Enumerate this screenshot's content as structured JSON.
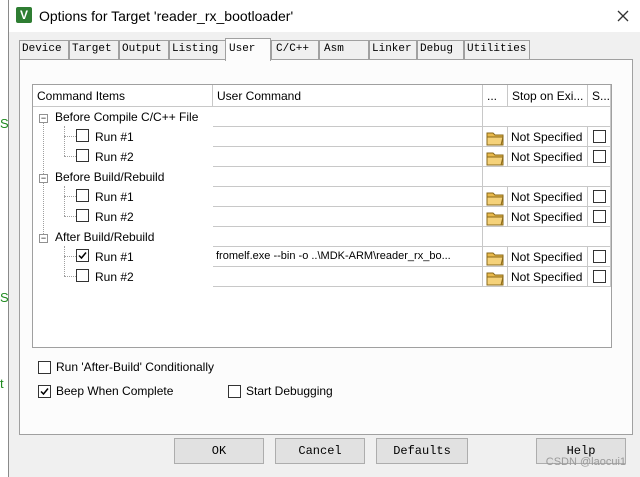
{
  "window": {
    "title": "Options for Target 'reader_rx_bootloader'",
    "icon_glyph": "V"
  },
  "tabs": [
    {
      "label": "Device"
    },
    {
      "label": "Target"
    },
    {
      "label": "Output"
    },
    {
      "label": "Listing"
    },
    {
      "label": "User"
    },
    {
      "label": "C/C++"
    },
    {
      "label": "Asm"
    },
    {
      "label": "Linker"
    },
    {
      "label": "Debug"
    },
    {
      "label": "Utilities"
    }
  ],
  "active_tab": "User",
  "grid": {
    "headers": [
      "Command Items",
      "User Command",
      "...",
      "Stop on Exi...",
      "S..."
    ],
    "groups": [
      {
        "label": "Before Compile C/C++ File",
        "expander": "−",
        "runs": [
          {
            "label": "Run #1",
            "checked": false,
            "command": "",
            "stop": "Not Specified"
          },
          {
            "label": "Run #2",
            "checked": false,
            "command": "",
            "stop": "Not Specified"
          }
        ]
      },
      {
        "label": "Before Build/Rebuild",
        "expander": "−",
        "runs": [
          {
            "label": "Run #1",
            "checked": false,
            "command": "",
            "stop": "Not Specified"
          },
          {
            "label": "Run #2",
            "checked": false,
            "command": "",
            "stop": "Not Specified"
          }
        ]
      },
      {
        "label": "After Build/Rebuild",
        "expander": "−",
        "runs": [
          {
            "label": "Run #1",
            "checked": true,
            "command": "fromelf.exe --bin -o  ..\\MDK-ARM\\reader_rx_bo...",
            "stop": "Not Specified"
          },
          {
            "label": "Run #2",
            "checked": false,
            "command": "",
            "stop": "Not Specified"
          }
        ]
      }
    ]
  },
  "options": {
    "run_after_build": {
      "label": "Run 'After-Build' Conditionally",
      "checked": false
    },
    "beep": {
      "label": "Beep When Complete",
      "checked": true
    },
    "start_debugging": {
      "label": "Start Debugging",
      "checked": false
    }
  },
  "buttons": {
    "ok": "OK",
    "cancel": "Cancel",
    "defaults": "Defaults",
    "help": "Help"
  },
  "watermark": "CSDN @laocui1",
  "background_editor": {
    "fragments": [
      "S",
      "S",
      "t"
    ]
  },
  "colors": {
    "dialog_bg": "#f0f0f0",
    "panel_bg": "#fcfcfc",
    "folder": "#e8b84a",
    "editor_text": "#1f8a1f"
  }
}
